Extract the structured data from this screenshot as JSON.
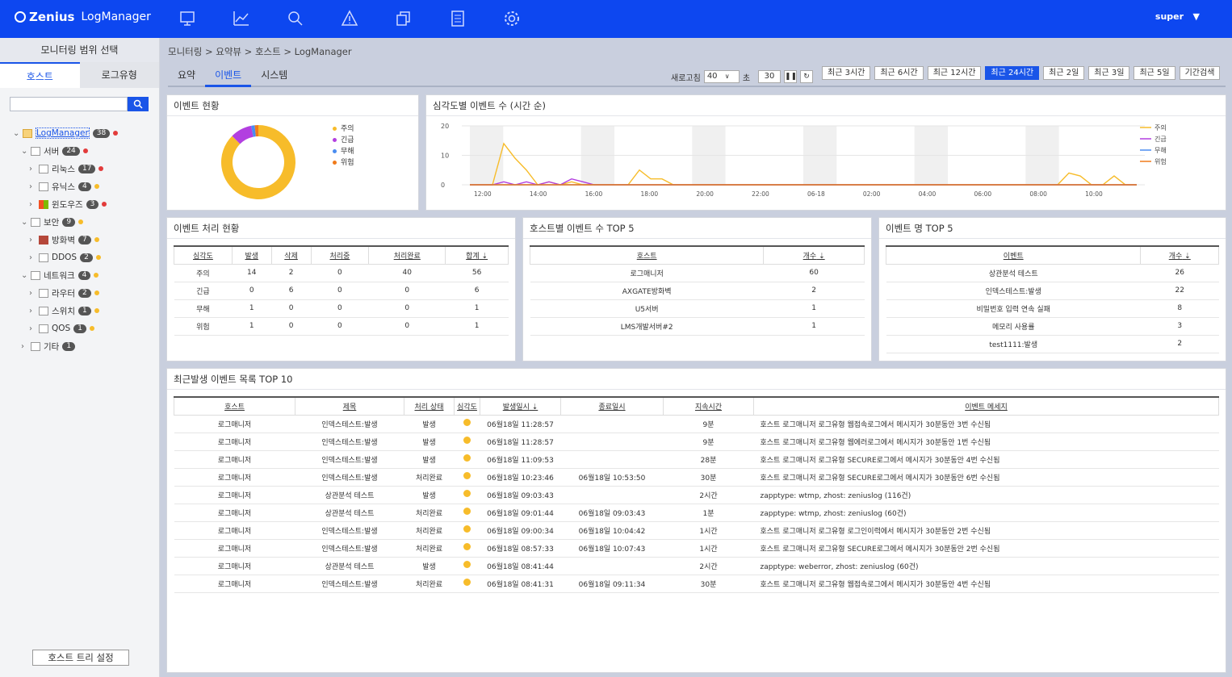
{
  "app": {
    "brand": "Zenius",
    "product": "LogManager",
    "user": "super"
  },
  "nav_icons": [
    "monitor-icon",
    "chart-icon",
    "search-icon",
    "alert-icon",
    "copy-icon",
    "document-icon",
    "gear-icon"
  ],
  "sidebar": {
    "title": "모니터링 범위 선택",
    "tabs": [
      "호스트",
      "로그유형"
    ],
    "search_placeholder": "",
    "settings_button": "호스트 트리 설정",
    "tree": [
      {
        "label": "LogManager",
        "count": "38",
        "status": "red",
        "level": 0
      },
      {
        "label": "서버",
        "count": "24",
        "status": "red",
        "level": 1
      },
      {
        "label": "리눅스",
        "count": "17",
        "status": "red",
        "level": 2
      },
      {
        "label": "유닉스",
        "count": "4",
        "status": "yellow",
        "level": 2
      },
      {
        "label": "윈도우즈",
        "count": "3",
        "status": "red",
        "level": 2
      },
      {
        "label": "보안",
        "count": "9",
        "status": "yellow",
        "level": 1
      },
      {
        "label": "방화벽",
        "count": "7",
        "status": "yellow",
        "level": 2
      },
      {
        "label": "DDOS",
        "count": "2",
        "status": "yellow",
        "level": 2
      },
      {
        "label": "네트워크",
        "count": "4",
        "status": "yellow",
        "level": 1
      },
      {
        "label": "라우터",
        "count": "2",
        "status": "yellow",
        "level": 2
      },
      {
        "label": "스위치",
        "count": "1",
        "status": "yellow",
        "level": 2
      },
      {
        "label": "QOS",
        "count": "1",
        "status": "yellow",
        "level": 2
      },
      {
        "label": "기타",
        "count": "1",
        "status": "",
        "level": 1
      }
    ]
  },
  "breadcrumb": "모니터링 > 요약뷰 > 호스트 > LogManager",
  "tabs": [
    "요약",
    "이벤트",
    "시스템"
  ],
  "refresh": {
    "label": "새로고침",
    "interval": "40",
    "unit": "초",
    "countdown": "30"
  },
  "ranges": [
    "최근 3시간",
    "최근 6시간",
    "최근 12시간",
    "최근 24시간",
    "최근 2일",
    "최근 3일",
    "최근 5일",
    "기간검색"
  ],
  "event_status": {
    "title": "이벤트 현황",
    "legend": [
      "주의",
      "긴급",
      "무해",
      "위험"
    ],
    "colors": [
      "#f7bc2a",
      "#b23fe0",
      "#4a8cf0",
      "#f07a1a"
    ]
  },
  "chart_data": [
    {
      "type": "pie",
      "title": "이벤트 현황",
      "categories": [
        "주의",
        "긴급",
        "무해",
        "위험"
      ],
      "values": [
        56,
        6,
        1,
        1
      ]
    },
    {
      "type": "line",
      "title": "심각도별 이벤트 수 (시간 순)",
      "x": [
        "12:00",
        "14:00",
        "16:00",
        "18:00",
        "20:00",
        "22:00",
        "06-18",
        "02:00",
        "04:00",
        "06:00",
        "08:00",
        "10:00"
      ],
      "ylim": [
        0,
        20
      ],
      "yticks": [
        0,
        10,
        20
      ],
      "series": [
        {
          "name": "주의",
          "color": "#f7bc2a",
          "values": [
            0,
            0,
            0,
            14,
            9,
            5,
            0,
            1,
            0,
            1,
            0,
            0,
            0,
            0,
            0,
            5,
            2,
            2,
            0,
            0,
            0,
            0,
            0,
            0,
            0,
            0,
            0,
            0,
            0,
            0,
            0,
            0,
            0,
            0,
            0,
            0,
            0,
            0,
            0,
            0,
            0,
            0,
            0,
            0,
            0,
            0,
            0,
            0,
            0,
            0,
            0,
            0,
            0,
            4,
            3,
            0,
            0,
            3,
            0,
            0
          ]
        },
        {
          "name": "긴급",
          "color": "#b23fe0",
          "values": [
            0,
            0,
            0,
            1,
            0,
            1,
            0,
            1,
            0,
            2,
            1,
            0,
            0,
            0,
            0,
            0,
            0,
            0,
            0,
            0,
            0,
            0,
            0,
            0,
            0,
            0,
            0,
            0,
            0,
            0,
            0,
            0,
            0,
            0,
            0,
            0,
            0,
            0,
            0,
            0,
            0,
            0,
            0,
            0,
            0,
            0,
            0,
            0,
            0,
            0,
            0,
            0,
            0,
            0,
            0,
            0,
            0,
            0,
            0,
            0
          ]
        },
        {
          "name": "무해",
          "color": "#4a8cf0",
          "values": [
            0,
            0,
            0,
            0,
            0,
            0,
            0,
            0,
            0,
            0,
            0,
            0,
            0,
            0,
            0,
            0,
            0,
            0,
            0,
            0,
            0,
            0,
            0,
            0,
            0,
            0,
            0,
            0,
            0,
            0,
            0,
            0,
            0,
            0,
            0,
            0,
            0,
            0,
            0,
            0,
            0,
            0,
            0,
            0,
            0,
            0,
            0,
            0,
            0,
            0,
            0,
            0,
            0,
            0,
            0,
            0,
            0,
            0,
            0,
            0
          ]
        },
        {
          "name": "위험",
          "color": "#f07a1a",
          "values": [
            0,
            0,
            0,
            0,
            0,
            0,
            0,
            0,
            0,
            0,
            0,
            0,
            0,
            0,
            0,
            0,
            0,
            0,
            0,
            0,
            0,
            0,
            0,
            0,
            0,
            0,
            0,
            0,
            0,
            0,
            0,
            0,
            0,
            0,
            0,
            0,
            0,
            0,
            0,
            0,
            0,
            0,
            0,
            0,
            0,
            0,
            0,
            0,
            0,
            0,
            0,
            0,
            0,
            0,
            0,
            0,
            0,
            0,
            0,
            0
          ]
        }
      ]
    }
  ],
  "processing": {
    "title": "이벤트 처리 현황",
    "headers": [
      "심각도",
      "발생",
      "삭제",
      "처리중",
      "처리완료",
      "합계"
    ],
    "rows": [
      [
        "주의",
        "14",
        "2",
        "0",
        "40",
        "56"
      ],
      [
        "긴급",
        "0",
        "6",
        "0",
        "0",
        "6"
      ],
      [
        "무해",
        "1",
        "0",
        "0",
        "0",
        "1"
      ],
      [
        "위험",
        "1",
        "0",
        "0",
        "0",
        "1"
      ]
    ]
  },
  "host_top5": {
    "title": "호스트별 이벤트 수 TOP 5",
    "headers": [
      "호스트",
      "개수"
    ],
    "rows": [
      [
        "로그매니저",
        "60"
      ],
      [
        "AXGATE방화벽",
        "2"
      ],
      [
        "U5서버",
        "1"
      ],
      [
        "LMS개발서버#2",
        "1"
      ]
    ]
  },
  "event_top5": {
    "title": "이벤트 명 TOP 5",
    "headers": [
      "이벤트",
      "개수"
    ],
    "rows": [
      [
        "상관분석 테스트",
        "26"
      ],
      [
        "인덱스테스트:발생",
        "22"
      ],
      [
        "비밀번호 입력 연속 실패",
        "8"
      ],
      [
        "메모리 사용률",
        "3"
      ],
      [
        "test1111:발생",
        "2"
      ]
    ]
  },
  "recent": {
    "title": "최근발생 이벤트 목록 TOP 10",
    "headers": [
      "호스트",
      "제목",
      "처리 상태",
      "심각도",
      "발생일시",
      "종료일시",
      "지속시간",
      "이벤트 메세지"
    ],
    "rows": [
      [
        "로그매니저",
        "인덱스테스트:발생",
        "발생",
        "",
        "06월18일 11:28:57",
        "",
        "9분",
        "호스트 로그매니저 로그유형 웹접속로그에서 메시지가 30분동안 3번 수신됨"
      ],
      [
        "로그매니저",
        "인덱스테스트:발생",
        "발생",
        "",
        "06월18일 11:28:57",
        "",
        "9분",
        "호스트 로그매니저 로그유형 웹에러로그에서 메시지가 30분동안 1번 수신됨"
      ],
      [
        "로그매니저",
        "인덱스테스트:발생",
        "발생",
        "",
        "06월18일 11:09:53",
        "",
        "28분",
        "호스트 로그매니저 로그유형 SECURE로그에서 메시지가 30분동안 4번 수신됨"
      ],
      [
        "로그매니저",
        "인덱스테스트:발생",
        "처리완료",
        "",
        "06월18일 10:23:46",
        "06월18일 10:53:50",
        "30분",
        "호스트 로그매니저 로그유형 SECURE로그에서 메시지가 30분동안 6번 수신됨"
      ],
      [
        "로그매니저",
        "상관분석 테스트",
        "발생",
        "",
        "06월18일 09:03:43",
        "",
        "2시간",
        "zapptype: wtmp, zhost: zeniuslog (116건)"
      ],
      [
        "로그매니저",
        "상관분석 테스트",
        "처리완료",
        "",
        "06월18일 09:01:44",
        "06월18일 09:03:43",
        "1분",
        "zapptype: wtmp, zhost: zeniuslog (60건)"
      ],
      [
        "로그매니저",
        "인덱스테스트:발생",
        "처리완료",
        "",
        "06월18일 09:00:34",
        "06월18일 10:04:42",
        "1시간",
        "호스트 로그매니저 로그유형 로그인이력에서 메시지가 30분동안 2번 수신됨"
      ],
      [
        "로그매니저",
        "인덱스테스트:발생",
        "처리완료",
        "",
        "06월18일 08:57:33",
        "06월18일 10:07:43",
        "1시간",
        "호스트 로그매니저 로그유형 SECURE로그에서 메시지가 30분동안 2번 수신됨"
      ],
      [
        "로그매니저",
        "상관분석 테스트",
        "발생",
        "",
        "06월18일 08:41:44",
        "",
        "2시간",
        "zapptype: weberror, zhost: zeniuslog (60건)"
      ],
      [
        "로그매니저",
        "인덱스테스트:발생",
        "처리완료",
        "",
        "06월18일 08:41:31",
        "06월18일 09:11:34",
        "30분",
        "호스트 로그매니저 로그유형 웹접속로그에서 메시지가 30분동안 4번 수신됨"
      ]
    ]
  }
}
